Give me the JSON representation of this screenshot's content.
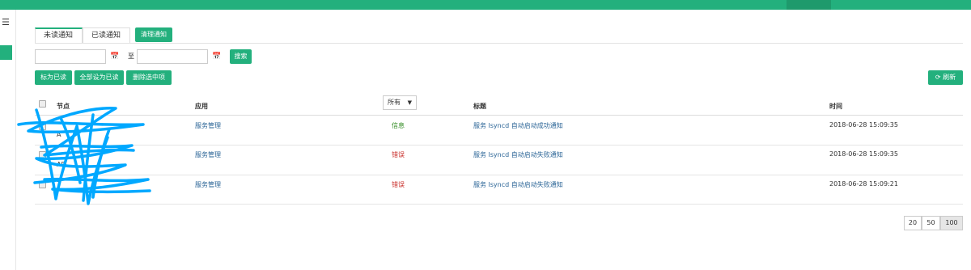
{
  "colors": {
    "accent": "#23b07d",
    "link": "#2a6496",
    "info": "#2f8a1f",
    "error": "#c9302c"
  },
  "nav": {
    "menu_icon": "menu-icon"
  },
  "tabs": [
    {
      "label": "未读通知",
      "active": true
    },
    {
      "label": "已读通知",
      "active": false
    }
  ],
  "toolbar": {
    "clear_label": "清理通知",
    "to_label": "至",
    "search_label": "搜索",
    "start_date": "",
    "end_date": "",
    "mark_read_label": "标为已读",
    "mark_all_read_label": "全部设为已读",
    "delete_selected_label": "删除选中项",
    "refresh_label": "刷新",
    "refresh_icon": "refresh-icon",
    "calendar_icon": "calendar-icon"
  },
  "table": {
    "columns": {
      "node": "节点",
      "app": "应用",
      "filter_value": "所有",
      "title": "标题",
      "time": "时间"
    },
    "rows": [
      {
        "node": "A",
        "app": "服务管理",
        "level": "信息",
        "level_type": "info",
        "title": "服务 lsyncd 自动启动成功通知",
        "time": "2018-06-28 15:09:35"
      },
      {
        "node": "API",
        "app": "服务管理",
        "level": "错误",
        "level_type": "error",
        "title": "服务 lsyncd 自动启动失败通知",
        "time": "2018-06-28 15:09:35"
      },
      {
        "node": "1",
        "app": "服务管理",
        "level": "错误",
        "level_type": "error",
        "title": "服务 lsyncd 自动启动失败通知",
        "time": "2018-06-28 15:09:21"
      }
    ]
  },
  "pagination": {
    "sizes": [
      "20",
      "50",
      "100"
    ],
    "active": "100"
  }
}
